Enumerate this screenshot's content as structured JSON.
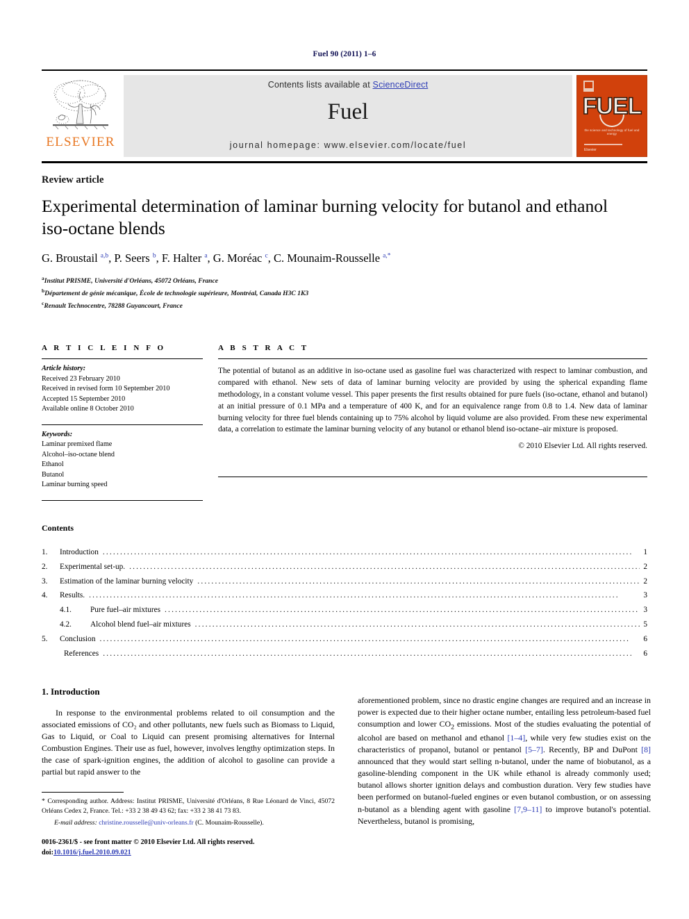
{
  "running_head": "Fuel 90 (2011) 1–6",
  "masthead": {
    "publisher_logo_text": "ELSEVIER",
    "contents_available_prefix": "Contents lists available at ",
    "sciencedirect": "ScienceDirect",
    "journal_name": "Fuel",
    "homepage": "journal homepage: www.elsevier.com/locate/fuel",
    "cover": {
      "title": "FUEL",
      "subtitle": "the science and technology of fuel and energy",
      "footer": "Elsevier"
    },
    "accent_orange": "#E87722",
    "cover_orange": "#d1410c",
    "link_blue": "#2c3bb5"
  },
  "article": {
    "kicker": "Review article",
    "title": "Experimental determination of laminar burning velocity for butanol and ethanol iso-octane blends",
    "authors_html": "G. Broustail <sup>a,b</sup>, P. Seers <sup>b</sup>, F. Halter <sup>a</sup>, G. Moréac <sup>c</sup>, C. Mounaim-Rousselle <sup>a,*</sup>",
    "affiliations": [
      {
        "mark": "a",
        "text": "Institut PRISME, Université d'Orléans, 45072 Orléans, France"
      },
      {
        "mark": "b",
        "text": "Département de génie mécanique, École de technologie supérieure, Montréal, Canada H3C 1K3"
      },
      {
        "mark": "c",
        "text": "Renault Technocentre, 78288 Guyancourt, France"
      }
    ]
  },
  "article_info": {
    "heading": "A R T I C L E    I N F O",
    "history_label": "Article history:",
    "history": [
      "Received 23 February 2010",
      "Received in revised form 10 September 2010",
      "Accepted 15 September 2010",
      "Available online 8 October 2010"
    ],
    "keywords_label": "Keywords:",
    "keywords": [
      "Laminar premixed flame",
      "Alcohol–iso-octane blend",
      "Ethanol",
      "Butanol",
      "Laminar burning speed"
    ]
  },
  "abstract": {
    "heading": "A B S T R A C T",
    "text": "The potential of butanol as an additive in iso-octane used as gasoline fuel was characterized with respect to laminar combustion, and compared with ethanol. New sets of data of laminar burning velocity are provided by using the spherical expanding flame methodology, in a constant volume vessel. This paper presents the first results obtained for pure fuels (iso-octane, ethanol and butanol) at an initial pressure of 0.1 MPa and a temperature of 400 K, and for an equivalence range from 0.8 to 1.4. New data of laminar burning velocity for three fuel blends containing up to 75% alcohol by liquid volume are also provided. From these new experimental data, a correlation to estimate the laminar burning velocity of any butanol or ethanol blend iso-octane–air mixture is proposed.",
    "copyright": "© 2010 Elsevier Ltd. All rights reserved."
  },
  "contents": {
    "title": "Contents",
    "entries": [
      {
        "num": "1.",
        "label": "Introduction",
        "page": "1",
        "sub": false
      },
      {
        "num": "2.",
        "label": "Experimental set-up.",
        "page": "2",
        "sub": false
      },
      {
        "num": "3.",
        "label": "Estimation of the laminar burning velocity",
        "page": "2",
        "sub": false
      },
      {
        "num": "4.",
        "label": "Results.",
        "page": "3",
        "sub": false
      },
      {
        "num": "4.1.",
        "label": "Pure fuel–air mixtures",
        "page": "3",
        "sub": true
      },
      {
        "num": "4.2.",
        "label": "Alcohol blend fuel–air mixtures",
        "page": "5",
        "sub": true
      },
      {
        "num": "5.",
        "label": "Conclusion",
        "page": "6",
        "sub": false
      },
      {
        "num": "",
        "label": "References",
        "page": "6",
        "sub": false
      }
    ]
  },
  "body": {
    "section_heading": "1. Introduction",
    "left_paragraph": "In response to the environmental problems related to oil consumption and the associated emissions of CO₂ and other pollutants, new fuels such as Biomass to Liquid, Gas to Liquid, or Coal to Liquid can present promising alternatives for Internal Combustion Engines. Their use as fuel, however, involves lengthy optimization steps. In the case of spark-ignition engines, the addition of alcohol to gasoline can provide a partial but rapid answer to the",
    "right_paragraph_html": "aforementioned problem, since no drastic engine changes are required and an increase in power is expected due to their higher octane number, entailing less petroleum-based fuel consumption and lower CO<sub>2</sub> emissions. Most of the studies evaluating the potential of alcohol are based on methanol and ethanol <span class=\"ref\">[1–4]</span>, while very few studies exist on the characteristics of propanol, butanol or pentanol <span class=\"ref\">[5–7]</span>. Recently, BP and DuPont <span class=\"ref\">[8]</span> announced that they would start selling n-butanol, under the name of biobutanol, as a gasoline-blending component in the UK while ethanol is already commonly used; butanol allows shorter ignition delays and combustion duration. Very few studies have been performed on butanol-fueled engines or even butanol combustion, or on assessing n-butanol as a blending agent with gasoline <span class=\"ref\">[7,9–11]</span> to improve butanol's potential. Nevertheless, butanol is promising,"
  },
  "footnotes": {
    "corresponding": "* Corresponding author. Address: Institut PRISME, Université d'Orléans, 8 Rue Léonard de Vinci, 45072 Orléans Cedex 2, France. Tel.: +33 2 38 49 43 62; fax: +33 2 38 41 73 83.",
    "email_label": "E-mail address:",
    "email": "christine.rousselle@univ-orleans.fr",
    "email_owner": "(C. Mounaim-Rousselle).",
    "imprint": "0016-2361/$ - see front matter © 2010 Elsevier Ltd. All rights reserved.",
    "doi_label": "doi:",
    "doi": "10.1016/j.fuel.2010.09.021"
  }
}
